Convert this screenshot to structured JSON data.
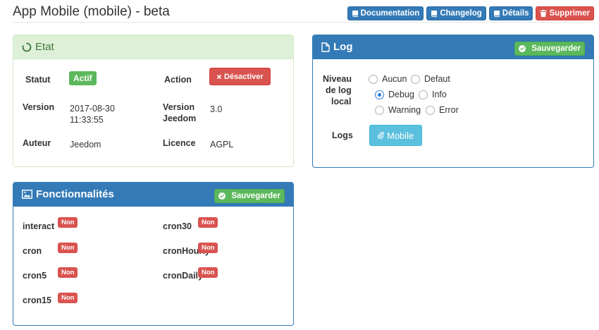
{
  "page": {
    "title": "App Mobile (mobile) - beta"
  },
  "toolbar": {
    "documentation": "Documentation",
    "changelog": "Changelog",
    "details": "Détails",
    "delete": "Supprimer"
  },
  "etat": {
    "title": "Etat",
    "statut_label": "Statut",
    "statut_value": "Actif",
    "action_label": "Action",
    "action_button": "Désactiver",
    "version_label": "Version",
    "version_value_line1": "2017-08-30",
    "version_value_line2": "11:33:55",
    "version_jeedom_line1": "Version",
    "version_jeedom_line2": "Jeedom",
    "version_jeedom_value": "3.0",
    "auteur_label": "Auteur",
    "auteur_value": "Jeedom",
    "licence_label": "Licence",
    "licence_value": "AGPL"
  },
  "log": {
    "title": "Log",
    "save": "Sauvegarder",
    "niveau_line1": "Niveau",
    "niveau_line2": "de log",
    "niveau_line3": "local",
    "options": [
      "Aucun",
      "Defaut",
      "Debug",
      "Info",
      "Warning",
      "Error"
    ],
    "selected": "Debug",
    "logs_label": "Logs",
    "logs_button": "Mobile"
  },
  "fonctionnalites": {
    "title": "Fonctionnalités",
    "save": "Sauvegarder",
    "items": [
      {
        "name": "interact",
        "status": "Non"
      },
      {
        "name": "cron30",
        "status": "Non"
      },
      {
        "name": "cron",
        "status": "Non"
      },
      {
        "name": "cronHourly",
        "status": "Non"
      },
      {
        "name": "cron5",
        "status": "Non"
      },
      {
        "name": "cronDaily",
        "status": "Non"
      },
      {
        "name": "cron15",
        "status": "Non"
      }
    ]
  },
  "colors": {
    "primary": "#337ab7",
    "success": "#5cb85c",
    "danger": "#d9534f",
    "info": "#5bc0de"
  },
  "icons": [
    "book-icon",
    "trash-icon",
    "refresh-icon",
    "file-icon",
    "check-circle-icon",
    "times-icon",
    "image-icon",
    "paperclip-icon"
  ]
}
